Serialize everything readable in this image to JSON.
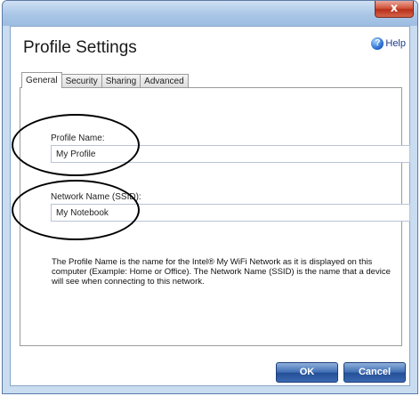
{
  "window": {
    "close_glyph": "x"
  },
  "header": {
    "title": "Profile Settings",
    "help_label": "Help",
    "help_icon": "?"
  },
  "tabs": [
    {
      "label": "General",
      "active": true
    },
    {
      "label": "Security",
      "active": false
    },
    {
      "label": "Sharing",
      "active": false
    },
    {
      "label": "Advanced",
      "active": false
    }
  ],
  "form": {
    "profile_name_label": "Profile Name:",
    "profile_name_value": "My Profile",
    "network_name_label": "Network Name (SSID):",
    "network_name_value": "My Notebook",
    "description": "The Profile Name is the name for the Intel® My WiFi Network as it is displayed on this computer (Example: Home or Office).  The Network Name (SSID) is the name that a device will see when connecting to this network."
  },
  "buttons": {
    "ok_label": "OK",
    "cancel_label": "Cancel"
  },
  "colors": {
    "title_bar": "#a9c6e6",
    "close_button": "#c7442b",
    "button_blue": "#3e6db3"
  }
}
